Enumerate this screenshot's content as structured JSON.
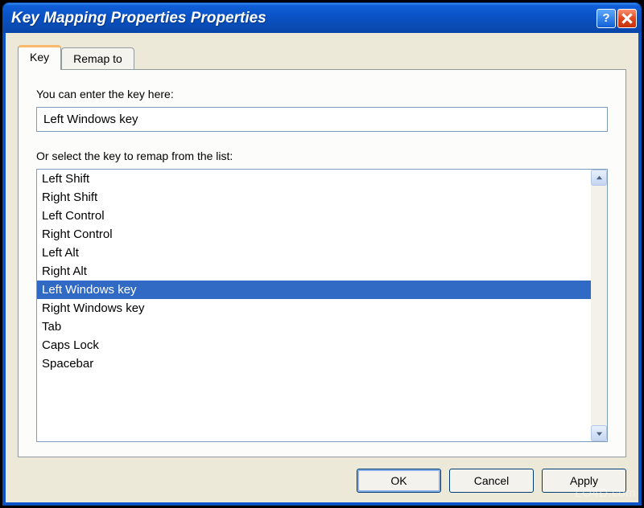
{
  "window": {
    "title": "Key Mapping Properties Properties"
  },
  "tabs": [
    {
      "label": "Key",
      "active": true
    },
    {
      "label": "Remap to",
      "active": false
    }
  ],
  "labels": {
    "enter_key": "You can enter the key here:",
    "select_key": "Or select the key to remap from the list:"
  },
  "input": {
    "value": "Left Windows key"
  },
  "list": {
    "items": [
      "Left Shift",
      "Right Shift",
      "Left Control",
      "Right Control",
      "Left Alt",
      "Right Alt",
      "Left Windows key",
      "Right Windows key",
      "Tab",
      "Caps Lock",
      "Spacebar"
    ],
    "selected_index": 6
  },
  "buttons": {
    "ok": "OK",
    "cancel": "Cancel",
    "apply": "Apply"
  },
  "watermark": "LO4D.com"
}
